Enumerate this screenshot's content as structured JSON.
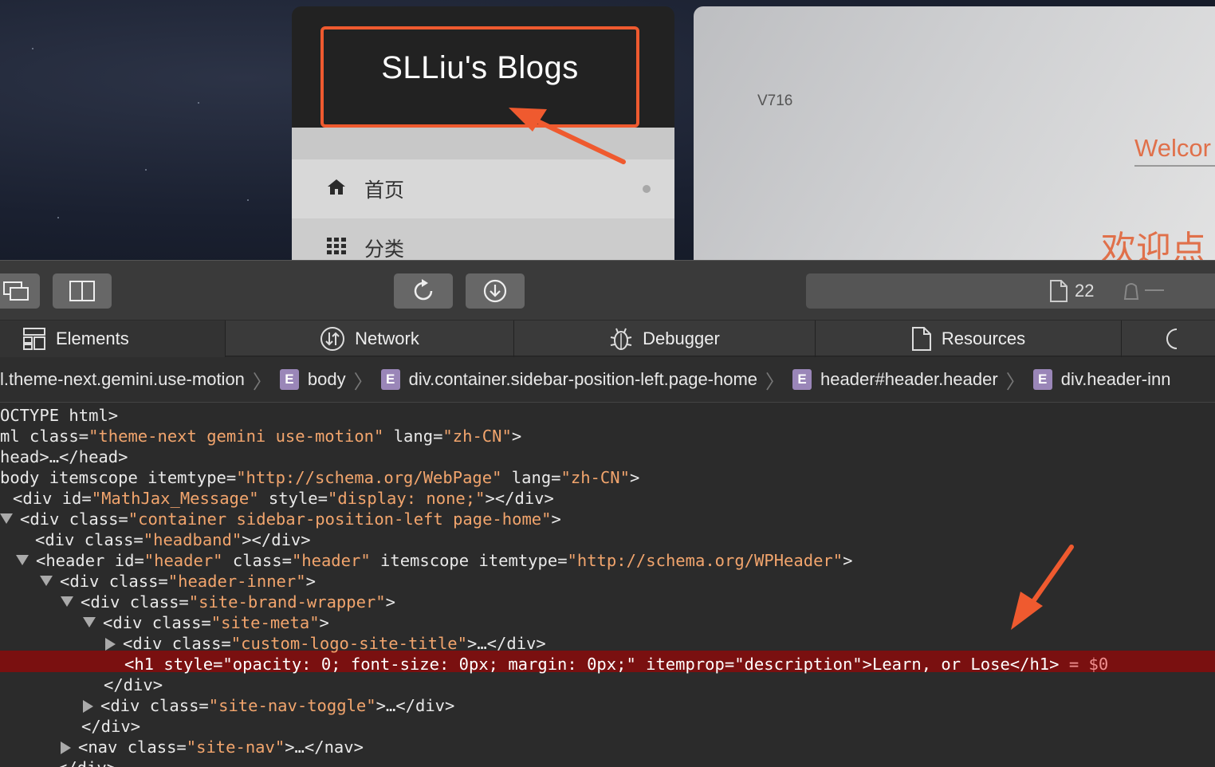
{
  "webpage": {
    "site_title": "SLLiu's Blogs",
    "menu": [
      {
        "label": "首页",
        "icon": "home-icon"
      },
      {
        "label": "分类",
        "icon": "grid-icon"
      }
    ],
    "version": "V716",
    "welcome_en": "Welcor",
    "welcome_cn": "欢迎点"
  },
  "devtools": {
    "resource_count": "22",
    "tabs": [
      "Elements",
      "Network",
      "Debugger",
      "Resources"
    ],
    "breadcrumb": [
      "l.theme-next.gemini.use-motion",
      "body",
      "div.container.sidebar-position-left.page-home",
      "header#header.header",
      "div.header-inn"
    ],
    "dom_lines": [
      {
        "tri": "",
        "text": "OCTYPE html>"
      },
      {
        "tri": "",
        "tag": "ml",
        "attrs": [
          {
            "n": "class",
            "v": "\"theme-next gemini use-motion\""
          },
          {
            "n": "lang",
            "v": "\"zh-CN\""
          }
        ],
        "end": ">"
      },
      {
        "tri": "",
        "text": "head>…</head>"
      },
      {
        "tri": "",
        "tag": "body",
        "attrs": [
          {
            "n": "itemscope",
            "v": ""
          },
          {
            "n": "itemtype",
            "v": "\"http://schema.org/WebPage\""
          },
          {
            "n": "lang",
            "v": "\"zh-CN\""
          }
        ],
        "end": ">"
      },
      {
        "tri": "",
        "tag": "<div",
        "attrs": [
          {
            "n": "id",
            "v": "\"MathJax_Message\""
          },
          {
            "n": "style",
            "v": "\"display: none;\""
          }
        ],
        "end": "></div>"
      },
      {
        "tri": "down",
        "tag": "<div",
        "attrs": [
          {
            "n": "class",
            "v": "\"container sidebar-position-left page-home\""
          }
        ],
        "end": ">"
      },
      {
        "tri": "",
        "tag": "<div",
        "attrs": [
          {
            "n": "class",
            "v": "\"headband\""
          }
        ],
        "end": "></div>"
      },
      {
        "tri": "down",
        "tag": "<header",
        "attrs": [
          {
            "n": "id",
            "v": "\"header\""
          },
          {
            "n": "class",
            "v": "\"header\""
          },
          {
            "n": "itemscope",
            "v": ""
          },
          {
            "n": "itemtype",
            "v": "\"http://schema.org/WPHeader\""
          }
        ],
        "end": ">"
      },
      {
        "tri": "down",
        "tag": "<div",
        "attrs": [
          {
            "n": "class",
            "v": "\"header-inner\""
          }
        ],
        "end": ">"
      },
      {
        "tri": "down",
        "tag": "<div",
        "attrs": [
          {
            "n": "class",
            "v": "\"site-brand-wrapper\""
          }
        ],
        "end": ">"
      },
      {
        "tri": "down",
        "tag": "<div",
        "attrs": [
          {
            "n": "class",
            "v": "\"site-meta\""
          }
        ],
        "end": ">"
      },
      {
        "tri": "right",
        "tag": "<div",
        "attrs": [
          {
            "n": "class",
            "v": "\"custom-logo-site-title\""
          }
        ],
        "end": ">…</div>"
      },
      {
        "tri": "",
        "selected": true,
        "text": "<h1 style=\"opacity: 0; font-size: 0px; margin: 0px;\" itemprop=\"description\">Learn, or Lose</h1>",
        "suffix": " = $0"
      },
      {
        "tri": "",
        "text": "</div>"
      },
      {
        "tri": "right",
        "tag": "<div",
        "attrs": [
          {
            "n": "class",
            "v": "\"site-nav-toggle\""
          }
        ],
        "end": ">…</div>"
      },
      {
        "tri": "",
        "text": "</div>"
      },
      {
        "tri": "right",
        "tag": "<nav",
        "attrs": [
          {
            "n": "class",
            "v": "\"site-nav\""
          }
        ],
        "end": ">…</nav>"
      },
      {
        "tri": "",
        "text": "</div>"
      }
    ]
  },
  "colors": {
    "accent": "#ef5a2f",
    "attr_value": "#f2a56d",
    "selection": "#7a1010"
  }
}
